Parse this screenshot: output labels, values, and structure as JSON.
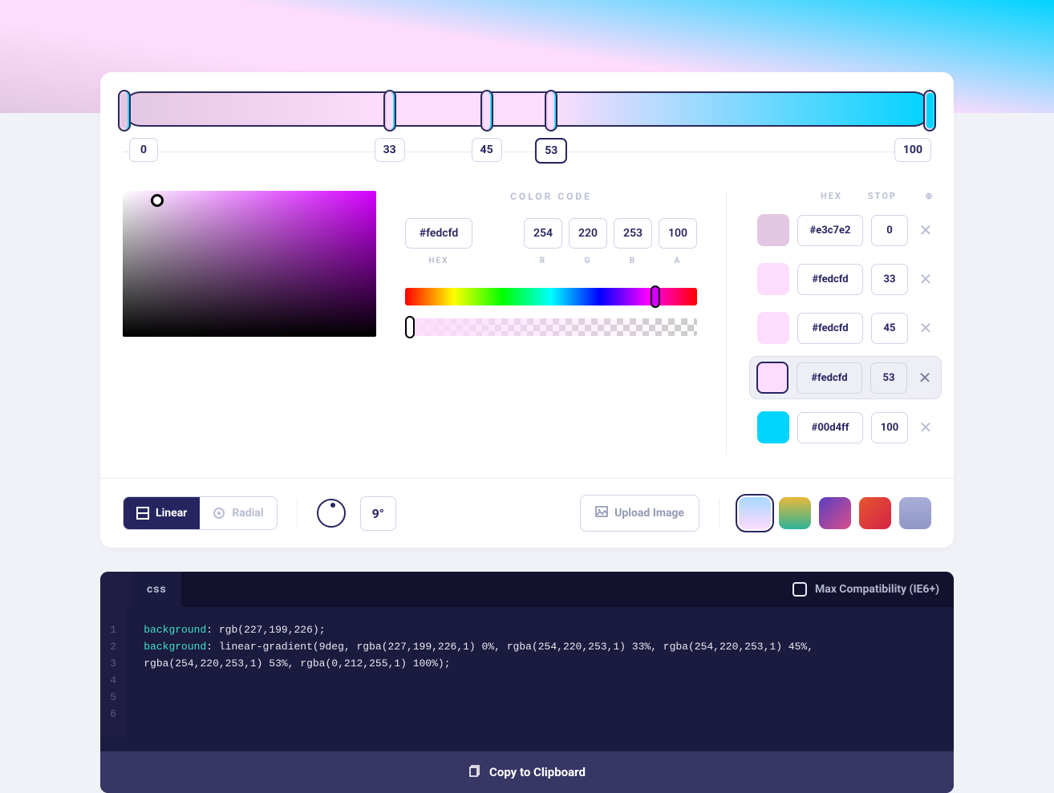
{
  "gradient": {
    "angle": "9°",
    "stops": [
      {
        "hex": "#e3c7e2",
        "pos": 0
      },
      {
        "hex": "#fedcfd",
        "pos": 33
      },
      {
        "hex": "#fedcfd",
        "pos": 45
      },
      {
        "hex": "#fedcfd",
        "pos": 53
      },
      {
        "hex": "#00d4ff",
        "pos": 100
      }
    ],
    "active_index": 3
  },
  "color_code": {
    "header": "COLOR CODE",
    "hex": "#fedcfd",
    "r": "254",
    "g": "220",
    "b": "253",
    "a": "100",
    "labels": {
      "hex": "HEX",
      "r": "R",
      "g": "G",
      "b": "B",
      "a": "A"
    }
  },
  "stop_list": {
    "hex_header": "HEX",
    "stop_header": "STOP"
  },
  "type_toggle": {
    "linear": "Linear",
    "radial": "Radial"
  },
  "upload_label": "Upload Image",
  "presets": [
    {
      "css": "linear-gradient(180deg,#a8d8ff,#fedcfd)"
    },
    {
      "css": "linear-gradient(180deg,#e8b93a,#2fb39a)"
    },
    {
      "css": "linear-gradient(135deg,#5a3fc0,#d94f8c)"
    },
    {
      "css": "linear-gradient(135deg,#e4572e,#d62246)"
    },
    {
      "css": "linear-gradient(180deg,#a8aed6,#9197c7)"
    }
  ],
  "code": {
    "tab": "css",
    "compat_label": "Max Compatibility (IE6+)",
    "line1_key": "background",
    "line1_val": " rgb(227,199,226);",
    "line2_key": "background",
    "line2_val": " linear-gradient(9deg, rgba(227,199,226,1) 0%, rgba(254,220,253,1) 33%, rgba(254,220,253,1) 45%, rgba(254,220,253,1) 53%, rgba(0,212,255,1) 100%);",
    "copy_label": "Copy to Clipboard"
  }
}
